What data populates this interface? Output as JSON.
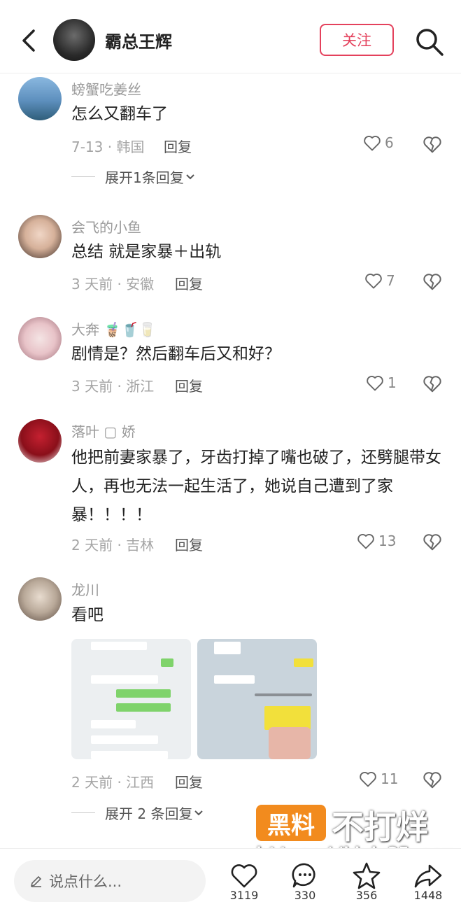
{
  "header": {
    "title": "霸总王辉",
    "follow_label": "关注"
  },
  "comments": [
    {
      "name": "螃蟹吃姜丝",
      "text": "怎么又翻车了",
      "meta": "7-13 · 韩国",
      "reply_label": "回复",
      "likes": "6",
      "expand": "展开1条回复"
    },
    {
      "name": "会飞的小鱼",
      "text": "总结 就是家暴＋出轨",
      "meta": "3 天前 · 安徽",
      "reply_label": "回复",
      "likes": "7"
    },
    {
      "name": "大奔 🧋🥤🥛",
      "text": "剧情是？然后翻车后又和好？",
      "meta": "3 天前 · 浙江",
      "reply_label": "回复",
      "likes": "1"
    },
    {
      "name": "落叶 ▢ 娇",
      "text": "他把前妻家暴了，牙齿打掉了嘴也破了，还劈腿带女人，再也无法一起生活了，她说自己遭到了家暴！！！！",
      "meta": "2 天前 · 吉林",
      "reply_label": "回复",
      "likes": "13"
    },
    {
      "name": "龙川",
      "text": "看吧",
      "meta": "2 天前 · 江西",
      "reply_label": "回复",
      "likes": "11",
      "expand": "展开 2 条回复"
    }
  ],
  "bottom": {
    "placeholder": "说点什么...",
    "like_count": "3119",
    "comment_count": "330",
    "collect_count": "356",
    "share_count": "1448"
  },
  "watermark": {
    "box": "黑料",
    "text": "不打烊",
    "url": "https://bbdy35.com"
  },
  "colors": {
    "accent": "#e4415c",
    "watermark_orange": "#f28b1e"
  }
}
